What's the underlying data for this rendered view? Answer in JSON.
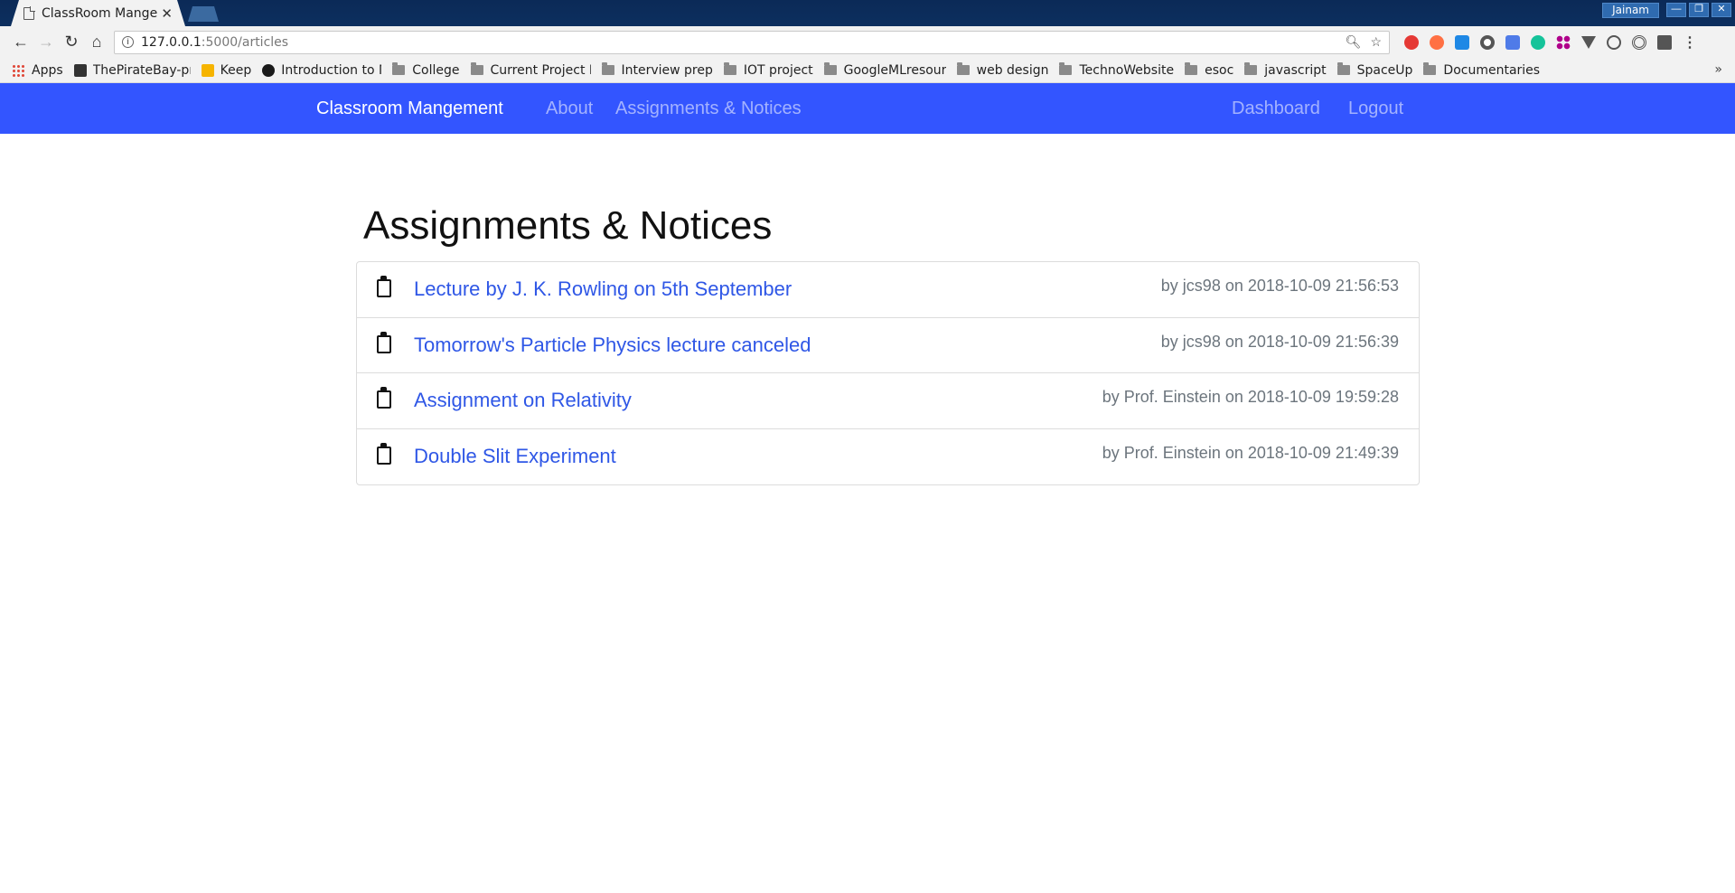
{
  "browser": {
    "tab_title": "ClassRoom Mangem",
    "tab_close": "✕",
    "profile": "Jainam",
    "window_controls": [
      "—",
      "❐",
      "✕"
    ],
    "url_host": "127.0.0.1",
    "url_path": ":5000/articles",
    "bookmarks": [
      {
        "label": "Apps",
        "icon": "apps-grid-icon"
      },
      {
        "label": "ThePirateBay-pr",
        "icon": "pirate-icon"
      },
      {
        "label": "Keep",
        "icon": "keep-icon"
      },
      {
        "label": "Introduction to M",
        "icon": "edx-icon"
      },
      {
        "label": "College",
        "icon": "folder-icon"
      },
      {
        "label": "Current Project F",
        "icon": "folder-icon"
      },
      {
        "label": "Interview prep",
        "icon": "folder-icon"
      },
      {
        "label": "IOT project",
        "icon": "folder-icon"
      },
      {
        "label": "GoogleMLresour",
        "icon": "folder-icon"
      },
      {
        "label": "web design",
        "icon": "folder-icon"
      },
      {
        "label": "TechnoWebsite",
        "icon": "folder-icon"
      },
      {
        "label": "esoc",
        "icon": "folder-icon"
      },
      {
        "label": "javascript",
        "icon": "folder-icon"
      },
      {
        "label": "SpaceUp",
        "icon": "folder-icon"
      },
      {
        "label": "Documentaries",
        "icon": "folder-icon"
      }
    ],
    "bookmarks_overflow": "»"
  },
  "navbar": {
    "brand": "Classroom Mangement",
    "about": "About",
    "assignments": "Assignments & Notices",
    "dashboard": "Dashboard",
    "logout": "Logout",
    "color": "#3355ff"
  },
  "main": {
    "title": "Assignments & Notices",
    "articles": [
      {
        "title": "Lecture by J. K. Rowling on 5th September",
        "meta": "by jcs98 on 2018-10-09 21:56:53"
      },
      {
        "title": "Tomorrow's Particle Physics lecture canceled",
        "meta": "by jcs98 on 2018-10-09 21:56:39"
      },
      {
        "title": "Assignment on Relativity",
        "meta": "by Prof. Einstein on 2018-10-09 19:59:28"
      },
      {
        "title": "Double Slit Experiment",
        "meta": "by Prof. Einstein on 2018-10-09 21:49:39"
      }
    ]
  }
}
